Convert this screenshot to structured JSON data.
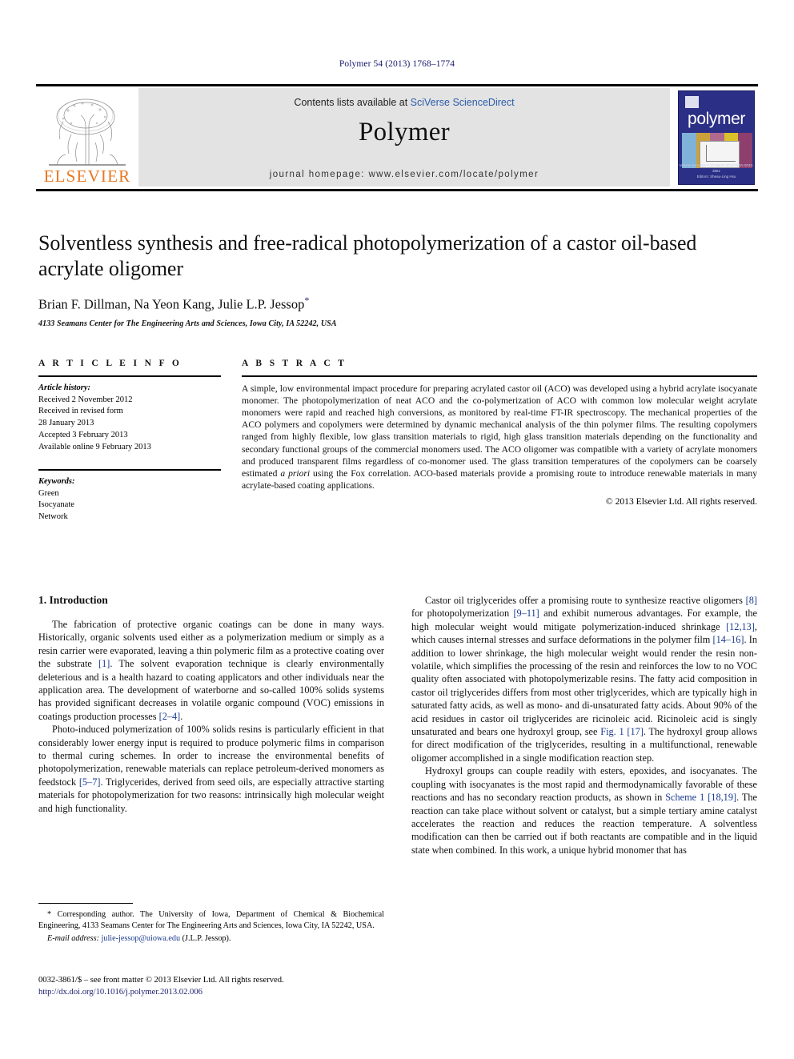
{
  "running_head": "Polymer 54 (2013) 1768–1774",
  "journal_header": {
    "contents_prefix": "Contents lists available at ",
    "sciencedirect": "SciVerse ScienceDirect",
    "journal_name": "Polymer",
    "homepage": "journal homepage: www.elsevier.com/locate/polymer",
    "publisher_wordmark": "ELSEVIER",
    "cover_word": "polymer",
    "cover_footer_1": "Volume 54 Issue 7 22 March 2013 ISSN 0032-3861",
    "cover_footer_2": "Editors: Sheau-Ling Hsu"
  },
  "article": {
    "title": "Solventless synthesis and free-radical photopolymerization of a castor oil-based acrylate oligomer",
    "authors": "Brian F. Dillman, Na Yeon Kang, Julie L.P. Jessop",
    "corresponding_marker": "*",
    "affiliation": "4133 Seamans Center for The Engineering Arts and Sciences, Iowa City, IA 52242, USA"
  },
  "article_info": {
    "heading": "A R T I C L E   I N F O",
    "history_label": "Article history:",
    "history": [
      "Received 2 November 2012",
      "Received in revised form",
      "28 January 2013",
      "Accepted 3 February 2013",
      "Available online 9 February 2013"
    ],
    "keywords_label": "Keywords:",
    "keywords": [
      "Green",
      "Isocyanate",
      "Network"
    ]
  },
  "abstract": {
    "heading": "A B S T R A C T",
    "part1": "A simple, low environmental impact procedure for preparing acrylated castor oil (ACO) was developed using a hybrid acrylate isocyanate monomer. The photopolymerization of neat ACO and the co-polymerization of ACO with common low molecular weight acrylate monomers were rapid and reached high conversions, as monitored by real-time FT-IR spectroscopy. The mechanical properties of the ACO polymers and copolymers were determined by dynamic mechanical analysis of the thin polymer films. The resulting copolymers ranged from highly flexible, low glass transition materials to rigid, high glass transition materials depending on the functionality and secondary functional groups of the commercial monomers used. The ACO oligomer was compatible with a variety of acrylate monomers and produced transparent films regardless of co-monomer used. The glass transition temperatures of the copolymers can be coarsely estimated ",
    "italic_phrase": "a priori",
    "part2": " using the Fox correlation. ACO-based materials provide a promising route to introduce renewable materials in many acrylate-based coating applications.",
    "copyright": "© 2013 Elsevier Ltd. All rights reserved."
  },
  "body": {
    "section_title": "1. Introduction",
    "left_paragraph_1_a": "The fabrication of protective organic coatings can be done in many ways. Historically, organic solvents used either as a polymerization medium or simply as a resin carrier were evaporated, leaving a thin polymeric film as a protective coating over the substrate ",
    "left_paragraph_1_ref1": "[1]",
    "left_paragraph_1_b": ". The solvent evaporation technique is clearly environmentally deleterious and is a health hazard to coating applicators and other individuals near the application area. The development of waterborne and so-called 100% solids systems has provided significant decreases in volatile organic compound (VOC) emissions in coatings production processes ",
    "left_paragraph_1_ref2": "[2–4]",
    "left_paragraph_1_c": ".",
    "left_paragraph_2_a": "Photo-induced polymerization of 100% solids resins is particularly efficient in that considerably lower energy input is required to produce polymeric films in comparison to thermal curing schemes. In order to increase the environmental benefits of photopolymerization, renewable materials can replace petroleum-derived monomers as feedstock ",
    "left_paragraph_2_ref1": "[5–7]",
    "left_paragraph_2_b": ". Triglycerides, derived from seed oils, are especially attractive starting materials for photopolymerization for two reasons: intrinsically high molecular weight and high functionality.",
    "right_paragraph_1_a": "Castor oil triglycerides offer a promising route to synthesize reactive oligomers ",
    "right_paragraph_1_ref1": "[8]",
    "right_paragraph_1_b": " for photopolymerization ",
    "right_paragraph_1_ref2": "[9–11]",
    "right_paragraph_1_c": " and exhibit numerous advantages. For example, the high molecular weight would mitigate polymerization-induced shrinkage ",
    "right_paragraph_1_ref3": "[12,13]",
    "right_paragraph_1_d": ", which causes internal stresses and surface deformations in the polymer film ",
    "right_paragraph_1_ref4": "[14–16]",
    "right_paragraph_1_e": ". In addition to lower shrinkage, the high molecular weight would render the resin non-volatile, which simplifies the processing of the resin and reinforces the low to no VOC quality often associated with photopolymerizable resins. The fatty acid composition in castor oil triglycerides differs from most other triglycerides, which are typically high in saturated fatty acids, as well as mono- and di-unsaturated fatty acids. About 90% of the acid residues in castor oil triglycerides are ricinoleic acid. Ricinoleic acid is singly unsaturated and bears one hydroxyl group, see ",
    "right_paragraph_1_ref5": "Fig. 1 [17]",
    "right_paragraph_1_f": ". The hydroxyl group allows for direct modification of the triglycerides, resulting in a multifunctional, renewable oligomer accomplished in a single modification reaction step.",
    "right_paragraph_2_a": "Hydroxyl groups can couple readily with esters, epoxides, and isocyanates. The coupling with isocyanates is the most rapid and thermodynamically favorable of these reactions and has no secondary reaction products, as shown in ",
    "right_paragraph_2_ref1": "Scheme 1 [18,19]",
    "right_paragraph_2_b": ". The reaction can take place without solvent or catalyst, but a simple tertiary amine catalyst accelerates the reaction and reduces the reaction temperature. A solventless modification can then be carried out if both reactants are compatible and in the liquid state when combined. In this work, a unique hybrid monomer that has"
  },
  "footnote": {
    "corresponding_marker": "*",
    "corresponding_text": " Corresponding author. The University of Iowa, Department of Chemical & Biochemical Engineering, 4133 Seamans Center for The Engineering Arts and Sciences, Iowa City, IA 52242, USA.",
    "email_label": "E-mail address:",
    "email": "julie-jessop@uiowa.edu",
    "email_suffix": " (J.L.P. Jessop)."
  },
  "issn": {
    "line": "0032-3861/$ – see front matter © 2013 Elsevier Ltd. All rights reserved.",
    "doi": "http://dx.doi.org/10.1016/j.polymer.2013.02.006"
  },
  "colors": {
    "elsevier_orange": "#E87722",
    "link_blue": "#1a3a8f",
    "cover_blue": "#2b2f86",
    "header_grey": "#e3e3e3"
  }
}
